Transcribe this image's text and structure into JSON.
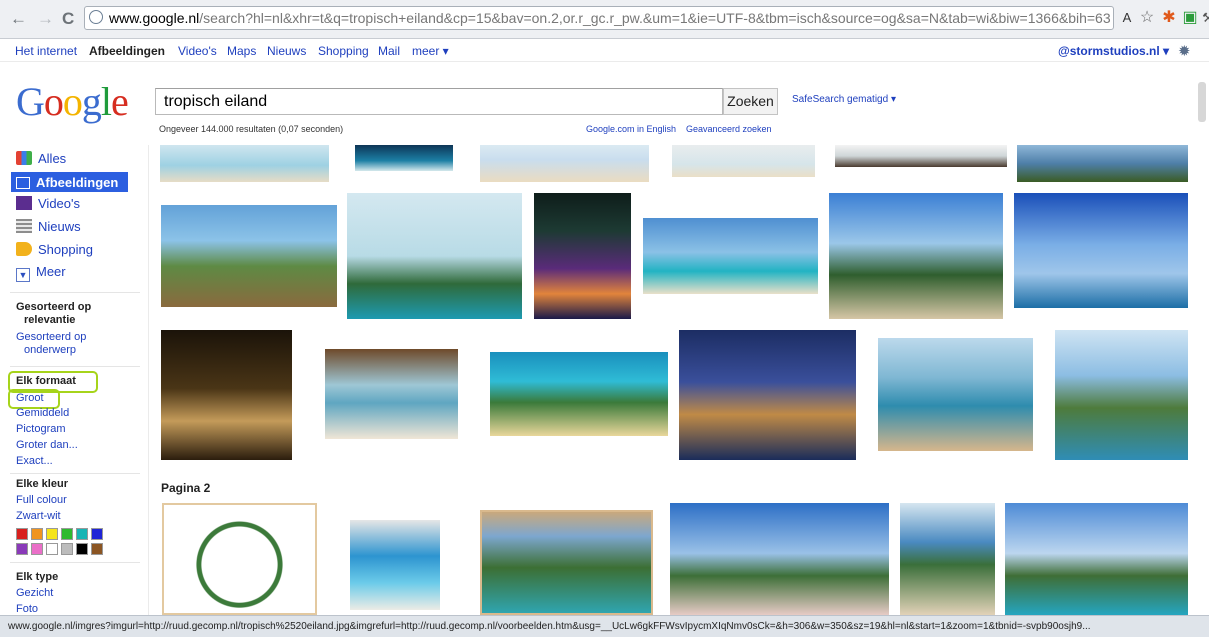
{
  "browser": {
    "url_host": "www.google.nl",
    "url_path": "/search?hl=nl&xhr=t&q=tropisch+eiland&cp=15&bav=on.2,or.r_gc.r_pw.&um=1&ie=UTF-8&tbm=isch&source=og&sa=N&tab=wi&biw=1366&bih=63"
  },
  "gbar": {
    "links": [
      "Het internet",
      "Afbeeldingen",
      "Video's",
      "Maps",
      "Nieuws",
      "Shopping",
      "Mail",
      "meer ▾"
    ],
    "account": "@stormstudios.nl ▾"
  },
  "logo": "Google",
  "search": {
    "query": "tropisch eiland",
    "button": "Zoeken",
    "safesearch": "SafeSearch gematigd ▾",
    "stats": "Ongeveer 144.000 resultaten (0,07 seconden)",
    "english": "Google.com in English",
    "advanced": "Geavanceerd zoeken"
  },
  "sidebar": {
    "nav": [
      "Alles",
      "Afbeeldingen",
      "Video's",
      "Nieuws",
      "Shopping",
      "Meer"
    ],
    "sort_heading": "Gesorteerd op",
    "sort_heading2": "relevantie",
    "sort_alt": "Gesorteerd op",
    "sort_alt2": "onderwerp",
    "size_heading": "Elk formaat",
    "sizes": [
      "Groot",
      "Gemiddeld",
      "Pictogram",
      "Groter dan...",
      "Exact..."
    ],
    "color_heading": "Elke kleur",
    "colors": [
      "Full colour",
      "Zwart-wit"
    ],
    "type_heading": "Elk type",
    "types": [
      "Gezicht",
      "Foto"
    ]
  },
  "swatch_colors": [
    "#d8201e",
    "#f0941f",
    "#f5e41b",
    "#2fba2f",
    "#18b4b4",
    "#1f24d6",
    "#8a3ab9",
    "#ea6fc8",
    "#ffffff",
    "#bcbcbc",
    "#000000",
    "#8b5523"
  ],
  "results": {
    "page_label": "Pagina 2"
  },
  "status": "www.google.nl/imgres?imgurl=http://ruud.gecomp.nl/tropisch%2520eiland.jpg&imgrefurl=http://ruud.gecomp.nl/voorbeelden.htm&usg=__UcLw6gkFFWsvIpycmXIqNmv0sCk=&h=306&w=350&sz=19&hl=nl&start=1&zoom=1&tbnid=-svpb90osjh9..."
}
